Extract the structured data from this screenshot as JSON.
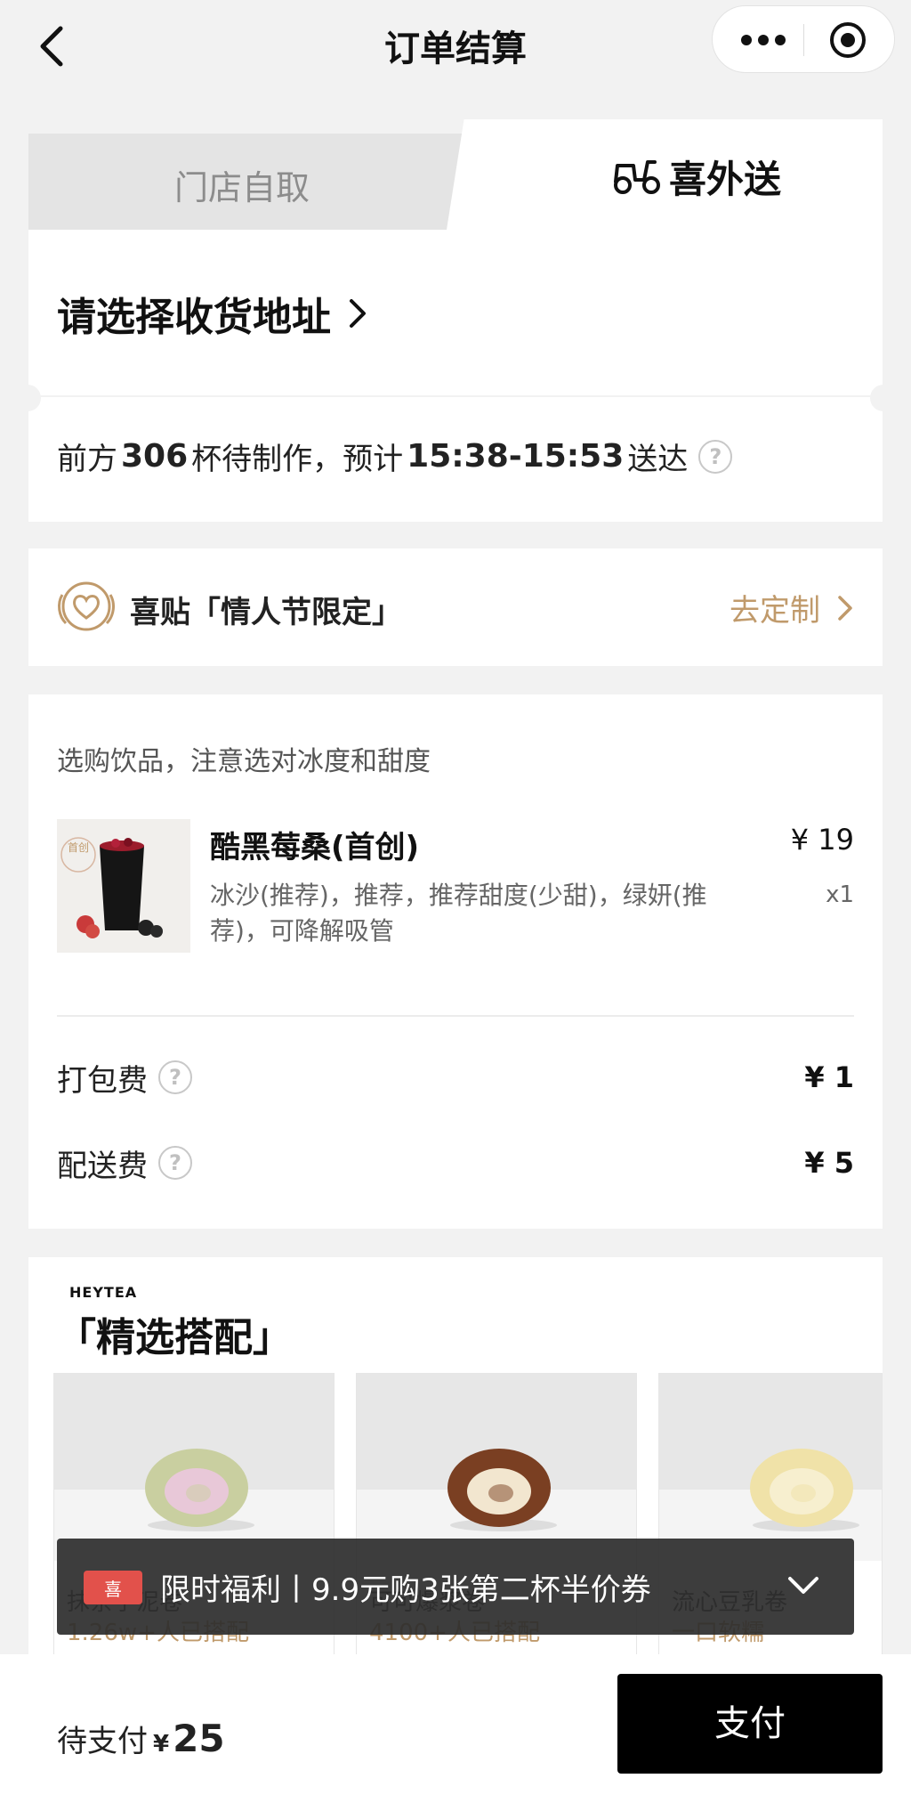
{
  "nav": {
    "title": "订单结算"
  },
  "tabs": {
    "pickup": "门店自取",
    "delivery": "喜外送"
  },
  "address": {
    "label": "请选择收货地址"
  },
  "queue": {
    "prefix": "前方",
    "cups": "306",
    "mid": "杯待制作，预计",
    "time": "15:38-15:53",
    "suffix": "送达"
  },
  "sticker": {
    "label": "喜贴「情人节限定」",
    "action": "去定制"
  },
  "order": {
    "hint": "选购饮品，注意选对冰度和甜度",
    "product": {
      "badge": "首创",
      "name": "酷黑莓桑(首创)",
      "spec": "冰沙(推荐)，推荐，推荐甜度(少甜)，绿妍(推荐)，可降解吸管",
      "price": "¥ 19",
      "qty": "x1"
    },
    "fees": [
      {
        "label": "打包费",
        "amount": "¥ 1"
      },
      {
        "label": "配送费",
        "amount": "¥ 5"
      }
    ]
  },
  "recommend": {
    "brand": "HEYTEA",
    "title": "「精选搭配」",
    "items": [
      {
        "name": "抹茶芋泥卷",
        "sub": "1.26w+人已搭配",
        "cream": "#e8c8d8",
        "cake": "#c9cfa0"
      },
      {
        "name": "可可爆浆卷",
        "sub": "4100+人已搭配",
        "cream": "#f2e6cf",
        "cake": "#7a3f22"
      },
      {
        "name": "流心豆乳卷",
        "sub": "一口软糯",
        "cream": "#f7efcf",
        "cake": "#f0e2a8"
      }
    ]
  },
  "promo": {
    "tag": "喜",
    "text": "限时福利丨9.9元购3张第二杯半价券"
  },
  "bottom": {
    "due_label": "待支付",
    "currency": "¥",
    "amount": "25",
    "pay": "支付"
  },
  "colors": {
    "accent": "#c09a6b",
    "pay_bg": "#000000",
    "coupon": "#e2514b"
  }
}
